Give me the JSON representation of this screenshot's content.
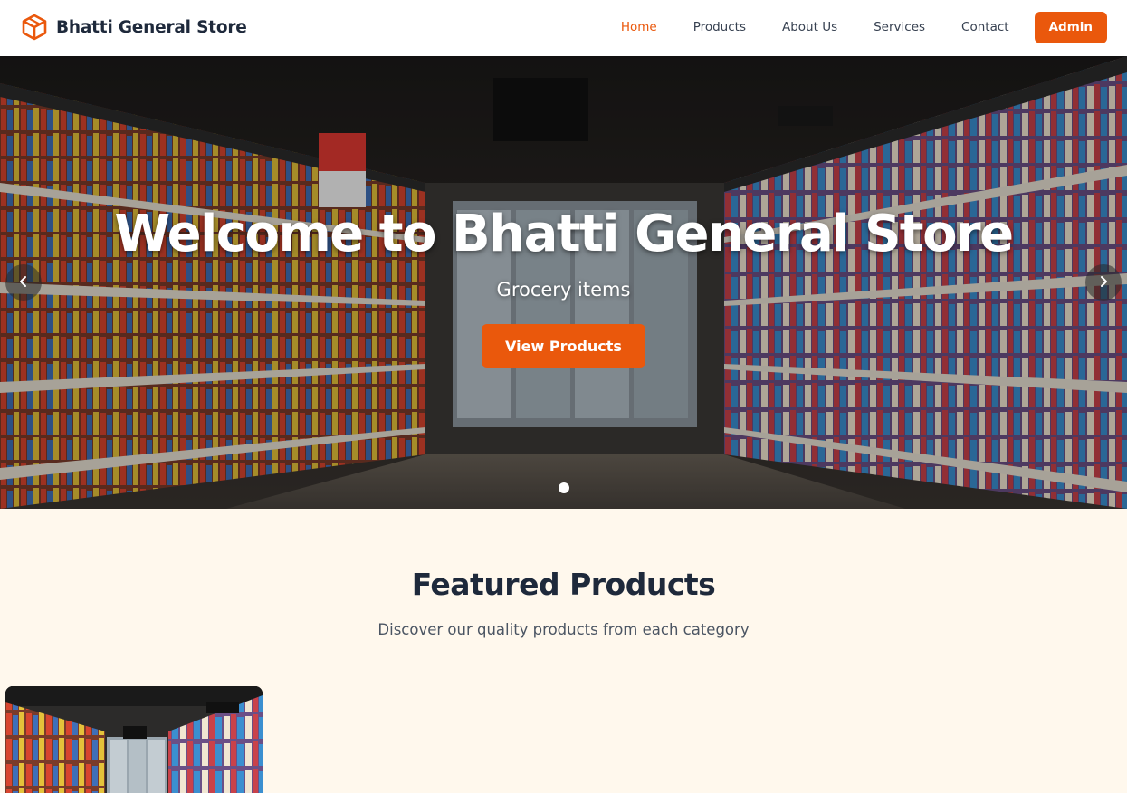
{
  "brand": {
    "name": "Bhatti General Store",
    "icon": "box-icon",
    "accent": "#ea580c"
  },
  "nav": {
    "links": [
      "Home",
      "Products",
      "About Us",
      "Services",
      "Contact"
    ],
    "active": "Home",
    "admin_label": "Admin"
  },
  "hero": {
    "title": "Welcome to Bhatti General Store",
    "subtitle": "Grocery items",
    "button_label": "View Products",
    "prev_icon": "chevron-left-icon",
    "next_icon": "chevron-right-icon",
    "slide_count": 1,
    "active_slide": 1
  },
  "featured": {
    "title": "Featured Products",
    "subtitle": "Discover our quality products from each category"
  },
  "colors": {
    "accent": "#ea580c",
    "page_bg": "#fff8ed",
    "heading": "#1e293b"
  }
}
